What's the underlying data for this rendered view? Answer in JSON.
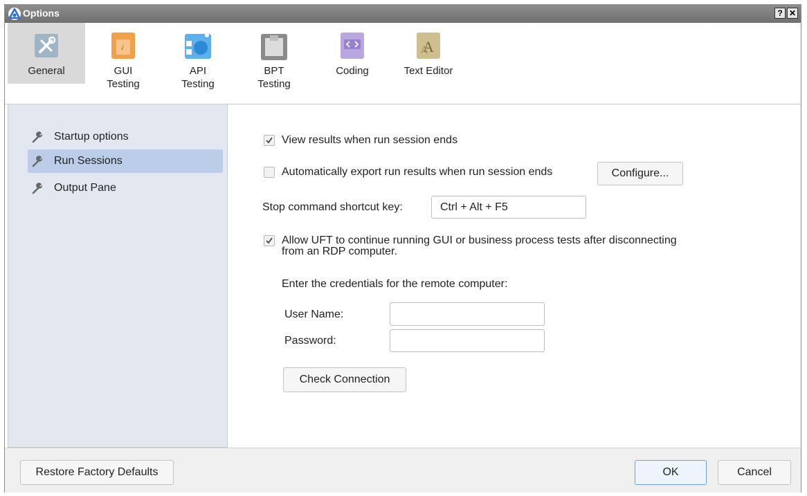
{
  "window": {
    "title": "Options",
    "help_glyph": "?",
    "close_glyph": "✕"
  },
  "categories": [
    {
      "label": "General",
      "icon": "tools-icon",
      "active": true
    },
    {
      "label": "GUI\nTesting",
      "icon": "gui-testing-icon"
    },
    {
      "label": "API\nTesting",
      "icon": "api-testing-icon"
    },
    {
      "label": "BPT\nTesting",
      "icon": "bpt-testing-icon"
    },
    {
      "label": "Coding",
      "icon": "coding-icon"
    },
    {
      "label": "Text Editor",
      "icon": "text-editor-icon"
    }
  ],
  "sidebar": {
    "items": [
      {
        "label": "Startup options",
        "icon": "wrench-icon"
      },
      {
        "label": "Run Sessions",
        "icon": "wrench-icon",
        "selected": true
      },
      {
        "label": "Output Pane",
        "icon": "wrench-icon"
      }
    ]
  },
  "content": {
    "view_results": {
      "label": "View results when run session ends",
      "checked": true
    },
    "auto_export": {
      "label": "Automatically export run results when run session ends",
      "checked": false
    },
    "configure_button": "Configure...",
    "shortcut": {
      "label": "Stop command shortcut key:",
      "value": "Ctrl + Alt + F5"
    },
    "allow_uft": {
      "label_line1": "Allow UFT to continue running GUI or business process tests after disconnecting",
      "label_line2": "from an RDP computer.",
      "checked": true
    },
    "credentials_prompt": "Enter the credentials for the remote computer:",
    "user_name": {
      "label": "User Name:",
      "value": ""
    },
    "password": {
      "label": "Password:",
      "value": ""
    },
    "check_connection_button": "Check Connection"
  },
  "footer": {
    "restore_button": "Restore Factory Defaults",
    "ok_button": "OK",
    "cancel_button": "Cancel"
  },
  "colors": {
    "sidebar_bg": "#e3e8f0",
    "selected_item_bg": "#bccde9",
    "titlebar_bg": "#7f7f7f",
    "ok_border": "#6f9fe0"
  }
}
